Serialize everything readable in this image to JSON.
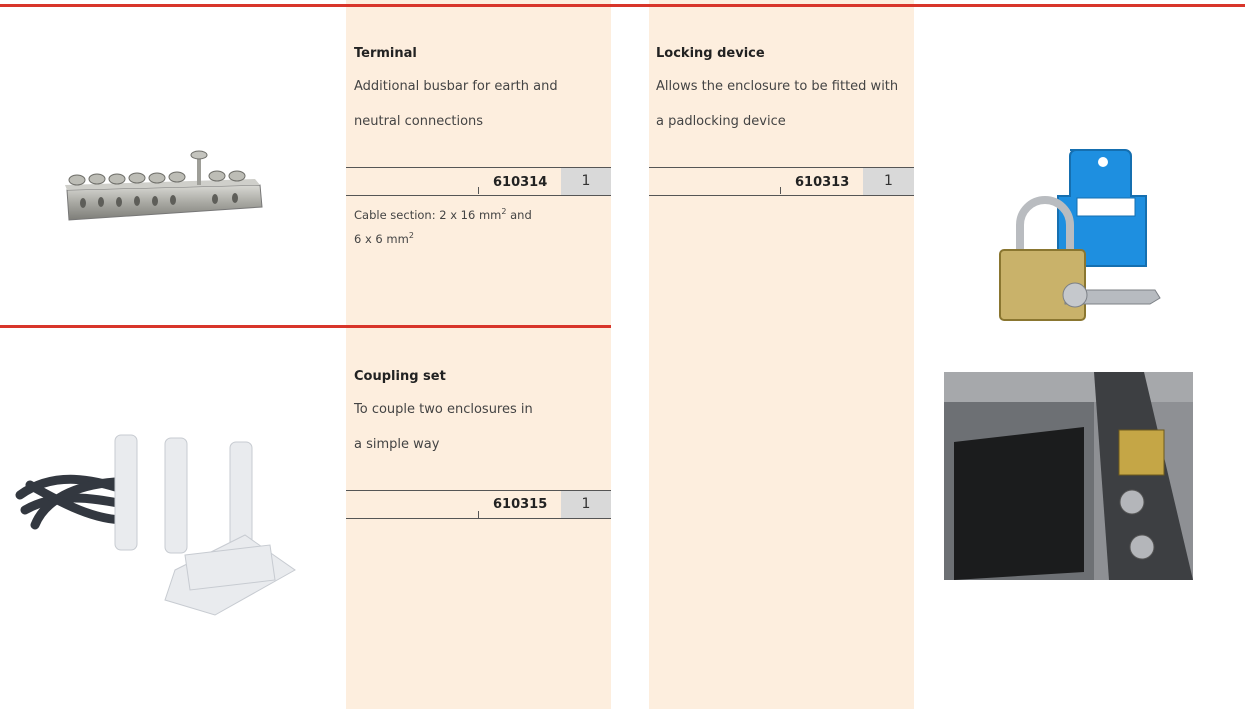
{
  "products": [
    {
      "title": "Terminal",
      "description_lines": [
        "Additional busbar for earth and",
        "neutral connections"
      ],
      "code": "610314",
      "qty": "1",
      "note": {
        "line1_prefix": "Cable section: 2 x 16 mm",
        "line1_sup": "2",
        "line1_suffix": " and",
        "line2_prefix": "6 x 6 mm",
        "line2_sup": "2"
      },
      "image": "busbar-terminal-image"
    },
    {
      "title": "Coupling set",
      "description_lines": [
        "To couple two enclosures in",
        "a simple way"
      ],
      "code": "610315",
      "qty": "1",
      "image": "coupling-set-image"
    },
    {
      "title": "Locking device",
      "description_lines": [
        "Allows the enclosure to be fitted with",
        "a padlocking device"
      ],
      "code": "610313",
      "qty": "1",
      "image": "padlock-device-image"
    }
  ],
  "colors": {
    "accent_line": "#d8352a",
    "panel_background": "#fdeede",
    "qty_box": "#d9d9d9"
  }
}
